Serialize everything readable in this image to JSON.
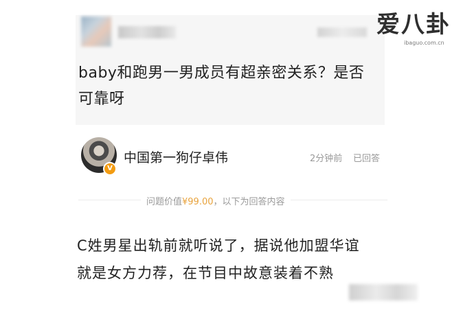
{
  "watermark": {
    "brand_text": "爱八卦",
    "url_text": "ibaguo.com.cn"
  },
  "question": {
    "text_line1": "baby和跑男一男成员有超亲密关系？是否",
    "text_line2": "可靠呀"
  },
  "answerer": {
    "name": "中国第一狗仔卓伟",
    "time": "2分钟前",
    "status": "已回答",
    "badge_icon": "verified-v-icon",
    "badge_glyph": "V"
  },
  "price": {
    "prefix": "问题价值",
    "value": "¥99.00",
    "suffix": "，以下为回答内容"
  },
  "answer": {
    "line1": "C姓男星出轨前就听说了，据说他加盟华谊",
    "line2": "就是女方力荐，在节目中故意装着不熟"
  },
  "colors": {
    "question_bg": "#f6f6f6",
    "accent_price": "#e8a33d",
    "badge": "#f39c12",
    "meta_text": "#9a9a9a"
  }
}
